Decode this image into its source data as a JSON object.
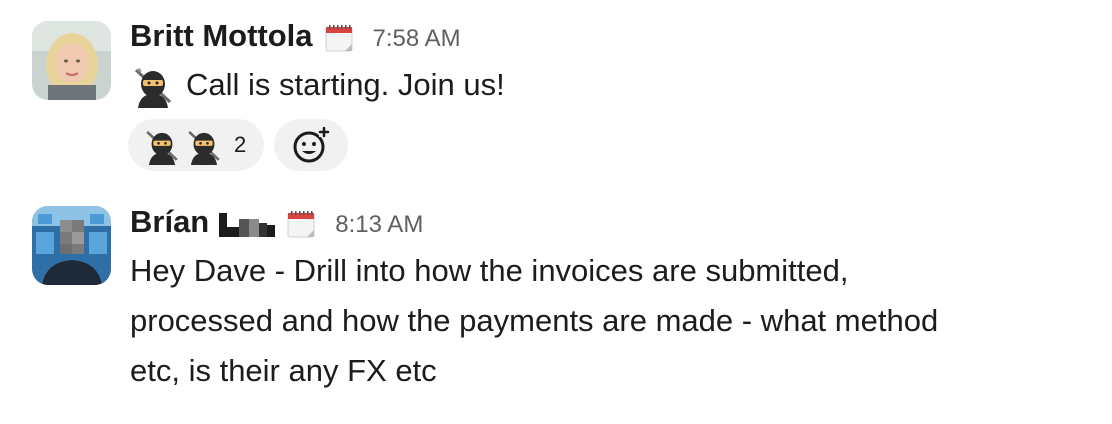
{
  "messages": [
    {
      "sender": "Britt Mottola",
      "status_icon": "calendar-icon",
      "timestamp": "7:58 AM",
      "inline_emoji": "ninja-emoji",
      "text": "Call is starting. Join us!",
      "reactions": [
        {
          "emoji": "ninja-emoji",
          "count": "2"
        }
      ],
      "add_reaction_icon": "add-reaction-icon"
    },
    {
      "sender": "Brían",
      "surname_redacted": true,
      "status_icon": "calendar-icon",
      "timestamp": "8:13 AM",
      "lines": [
        "Hey Dave - Drill into how the invoices are submitted,",
        "processed and how the payments are made - what method",
        "etc, is their any FX etc"
      ]
    }
  ],
  "colors": {
    "text": "#1d1c1d",
    "timestamp": "#616061",
    "reaction_bg": "#f1f1f1"
  }
}
